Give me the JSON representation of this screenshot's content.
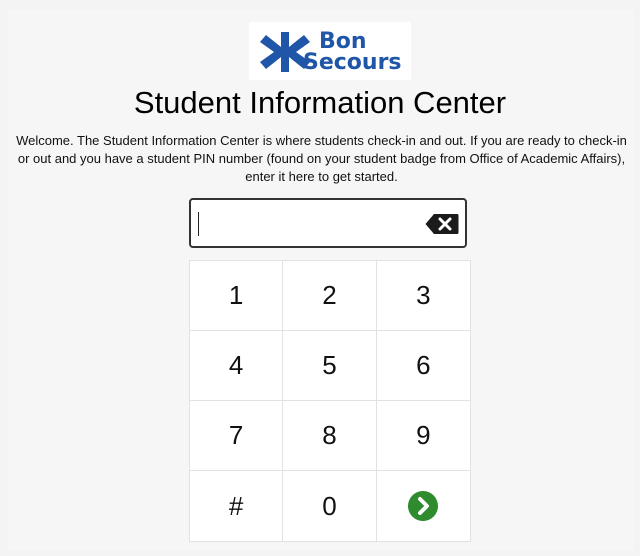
{
  "logo": {
    "line1": "Bon",
    "line2": "Secours",
    "brand_color": "#1f56a8"
  },
  "title": "Student Information Center",
  "welcome_text": "Welcome. The Student Information Center is where students check-in and out. If you are ready to check-in or out and you have a student PIN number (found on your student badge from Office of Academic Affairs), enter it here to get started.",
  "pin": {
    "value": "",
    "backspace_icon": "backspace-icon"
  },
  "keypad": {
    "keys": [
      "1",
      "2",
      "3",
      "4",
      "5",
      "6",
      "7",
      "8",
      "9",
      "#",
      "0"
    ],
    "submit_icon": "arrow-right-circle-icon",
    "submit_color": "#2e8b2e"
  }
}
